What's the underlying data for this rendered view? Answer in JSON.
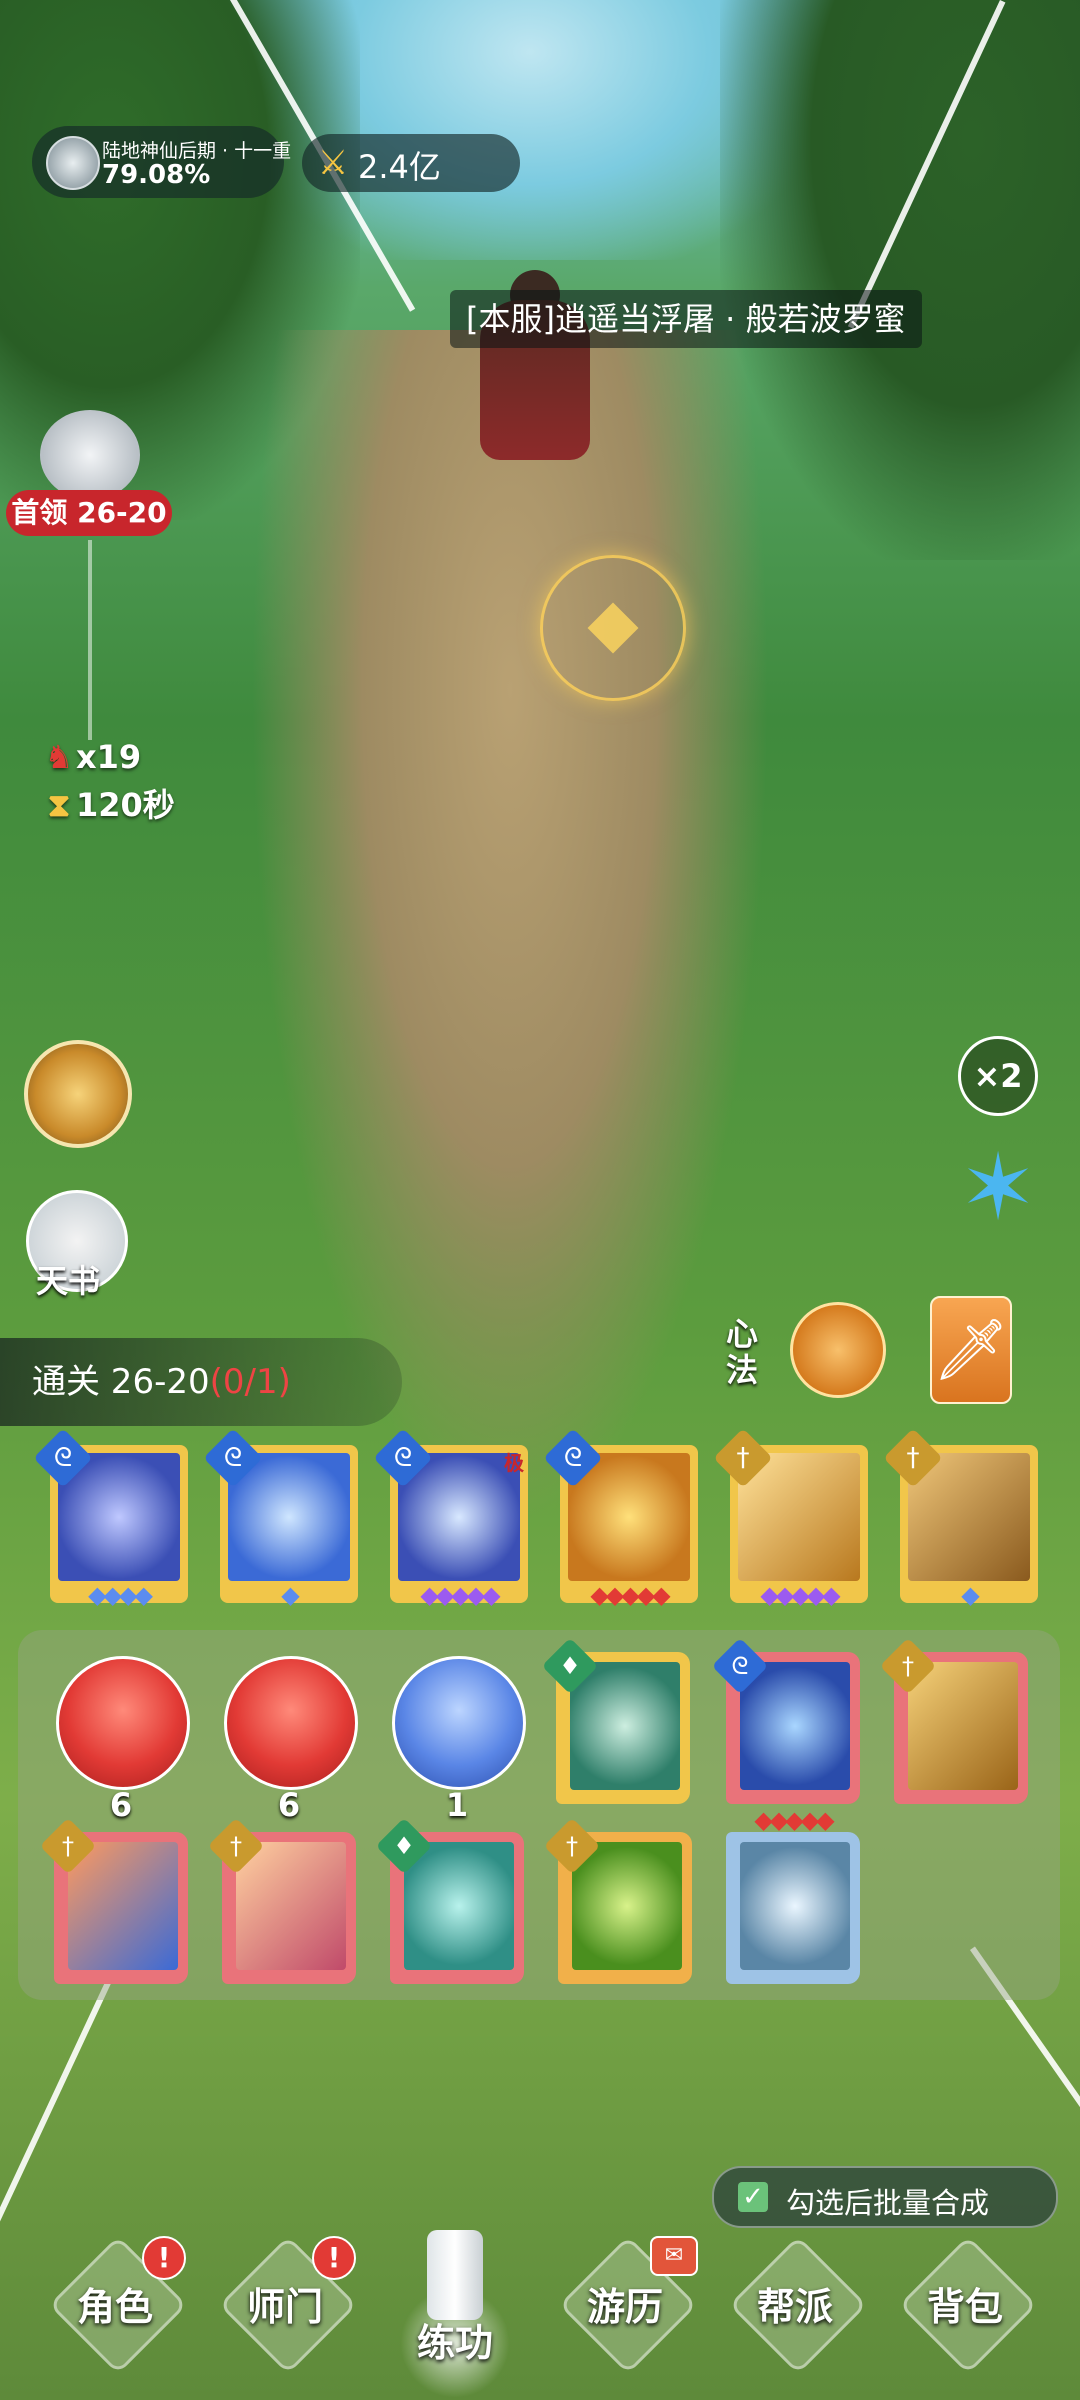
{
  "hud": {
    "realm_name": "陆地神仙后期 · 十一重",
    "realm_progress": "79.08%",
    "power": "2.4亿"
  },
  "player": {
    "name_tag": "[本服]逍遥当浮屠 · 般若波罗蜜"
  },
  "boss": {
    "label": "首领 26-20",
    "enemy_count": "x19",
    "timer": "120秒"
  },
  "side_buttons": {
    "book_label": "天书",
    "speed_label": "×2",
    "xinfa_label": "心法"
  },
  "stage": {
    "clear_prefix": "通关 26-20",
    "clear_count": "(0/1)"
  },
  "skill_bar": [
    {
      "element": "wind-icon",
      "pips": "◆◆◆◆",
      "pip_color": "#5b8cf0"
    },
    {
      "element": "wind-icon",
      "pips": "◆",
      "pip_color": "#5b8cf0"
    },
    {
      "element": "wind-icon",
      "pips": "◆◆◆◆◆",
      "pip_color": "#9b5bf0",
      "tag": "极"
    },
    {
      "element": "wind-icon",
      "pips": "◆◆◆◆◆",
      "pip_color": "#e23a35"
    },
    {
      "element": "sword-icon",
      "pips": "◆◆◆◆◆",
      "pip_color": "#9b5bf0"
    },
    {
      "element": "sword-icon",
      "pips": "◆",
      "pip_color": "#5b8cf0"
    }
  ],
  "inventory": {
    "orbs": [
      {
        "count": "6",
        "color": "red"
      },
      {
        "count": "6",
        "color": "red"
      },
      {
        "count": "1",
        "color": "blue"
      }
    ],
    "books": [
      {
        "element": "leaf-icon"
      },
      {
        "element": "wind-icon",
        "pips": "◆◆◆◆◆"
      },
      {
        "element": "sword-icon"
      },
      {
        "element": "sword-icon"
      },
      {
        "element": "sword-icon"
      },
      {
        "element": "leaf-icon"
      },
      {
        "element": "sword-icon"
      },
      {
        "element": "none"
      }
    ]
  },
  "batch": {
    "checked": true,
    "label": "勾选后批量合成"
  },
  "nav": [
    {
      "label": "角色",
      "alert": "!"
    },
    {
      "label": "师门",
      "alert": "!"
    },
    {
      "label": "练功"
    },
    {
      "label": "游历",
      "gift": "✉"
    },
    {
      "label": "帮派"
    },
    {
      "label": "背包"
    }
  ]
}
